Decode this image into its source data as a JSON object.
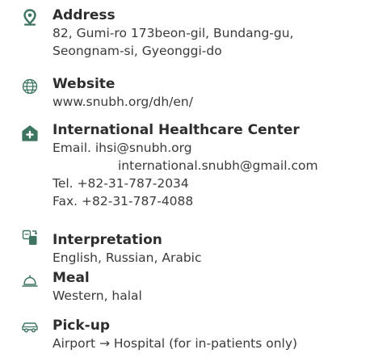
{
  "icon_color": "#3d7560",
  "items": [
    {
      "icon": "location-pin-icon",
      "title": "Address",
      "lines": [
        "82, Gumi-ro 173beon-gil, Bundang-gu,",
        "Seongnam-si, Gyeonggi-do"
      ]
    },
    {
      "icon": "globe-icon",
      "title": "Website",
      "lines": [
        "www.snubh.org/dh/en/"
      ]
    },
    {
      "icon": "hospital-house-icon",
      "title": "International Healthcare Center",
      "lines": [
        "Email. ihsi@snubh.org",
        "international.snubh@gmail.com",
        "Tel. +82-31-787-2034",
        "Fax. +82-31-787-4088"
      ]
    },
    {
      "icon": "translate-phone-icon",
      "title": "Interpretation",
      "lines": [
        "English, Russian, Arabic"
      ]
    },
    {
      "icon": "meal-cloche-icon",
      "title": "Meal",
      "lines": [
        "Western, halal"
      ]
    },
    {
      "icon": "car-icon",
      "title": "Pick-up",
      "lines": [
        "Airport → Hospital (for in-patients only)"
      ]
    }
  ]
}
